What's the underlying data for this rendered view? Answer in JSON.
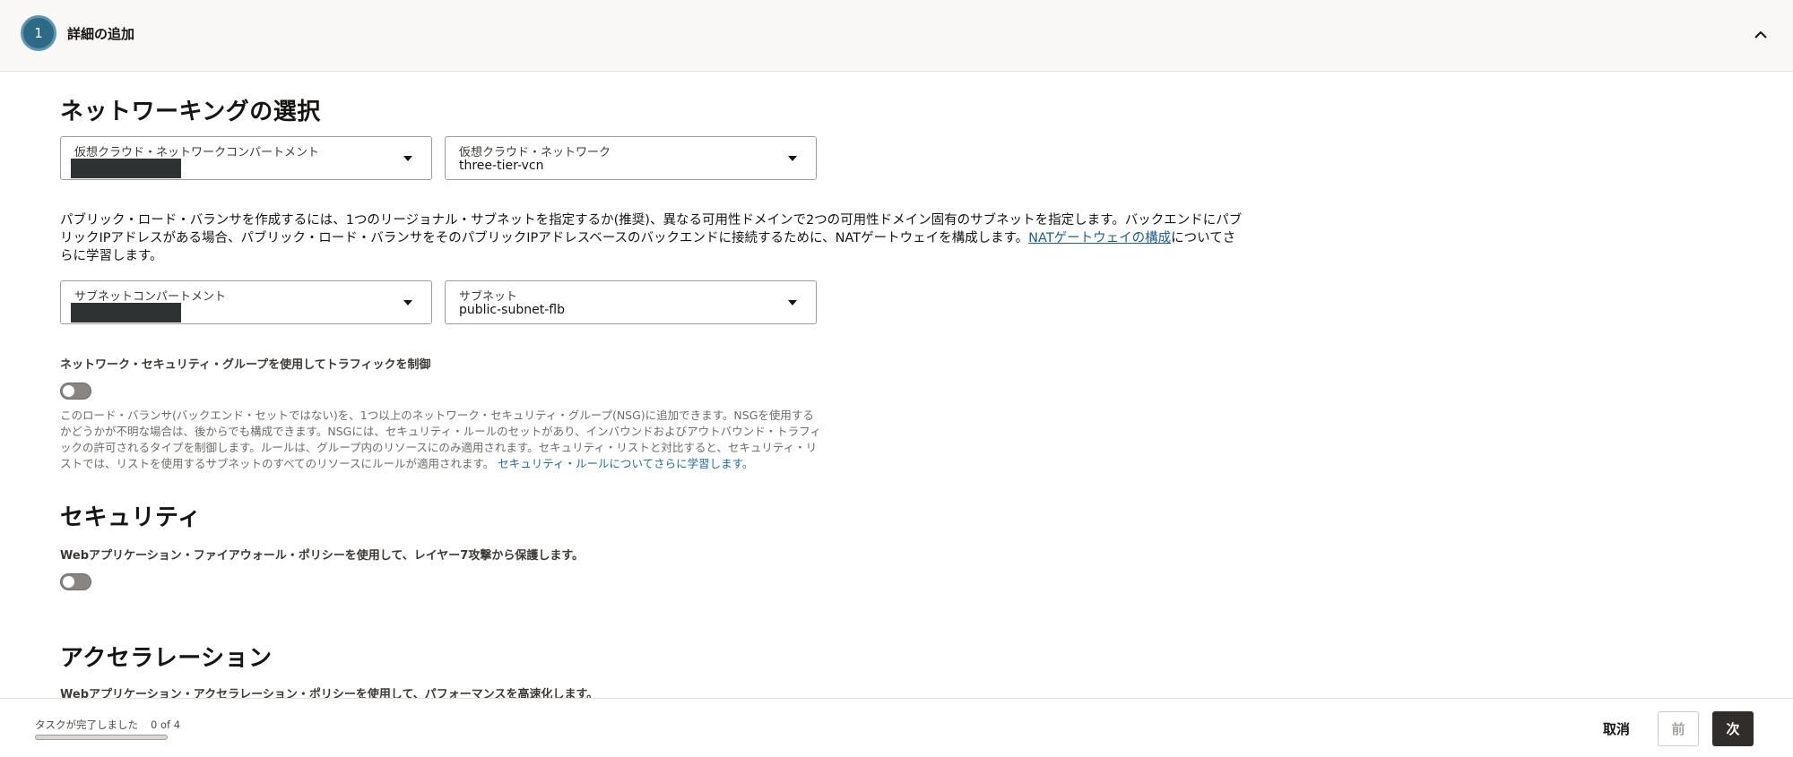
{
  "step": {
    "number": "1",
    "title": "詳細の追加",
    "collapse_icon": "chevron-up-icon"
  },
  "networking": {
    "heading": "ネットワーキングの選択",
    "vcn_compartment": {
      "label": "仮想クラウド・ネットワークコンパートメント",
      "value": ""
    },
    "vcn": {
      "label": "仮想クラウド・ネットワーク",
      "value": "three-tier-vcn"
    },
    "description": "パブリック・ロード・バランサを作成するには、1つのリージョナル・サブネットを指定するか(推奨)、異なる可用性ドメインで2つの可用性ドメイン固有のサブネットを指定します。バックエンドにパブリックIPアドレスがある場合、パブリック・ロード・バランサをそのパブリックIPアドレスベースのバックエンドに接続するために、NATゲートウェイを構成します。",
    "description_link": "NATゲートウェイの構成",
    "description_suffix": "についてさらに学習します。",
    "subnet_compartment": {
      "label": "サブネットコンパートメント",
      "value": ""
    },
    "subnet": {
      "label": "サブネット",
      "value": "public-subnet-flb"
    },
    "nsg_label": "ネットワーク・セキュリティ・グループを使用してトラフィックを制御",
    "nsg_toggle_on": false,
    "nsg_help": "このロード・バランサ(バックエンド・セットではない)を、1つ以上のネットワーク・セキュリティ・グループ(NSG)に追加できます。NSGを使用するかどうかが不明な場合は、後からでも構成できます。NSGには、セキュリティ・ルールのセットがあり、インバウンドおよびアウトバウンド・トラフィックの許可されるタイプを制御します。ルールは、グループ内のリソースにのみ適用されます。セキュリティ・リストと対比すると、セキュリティ・リストでは、リストを使用するサブネットのすべてのリソースにルールが適用されます。",
    "nsg_help_link": "セキュリティ・ルールについてさらに学習します。"
  },
  "security": {
    "heading": "セキュリティ",
    "waf_label": "Webアプリケーション・ファイアウォール・ポリシーを使用して、レイヤー7攻撃から保護します。",
    "waf_toggle_on": false
  },
  "acceleration": {
    "heading": "アクセラレーション",
    "label": "Webアプリケーション・アクセラレーション・ポリシーを使用して、パフォーマンスを高速化します。"
  },
  "footer": {
    "task_label": "タスクが完了しました",
    "task_count": "0 of 4",
    "progress_fraction": 0,
    "cancel": "取消",
    "prev": "前",
    "next": "次"
  }
}
